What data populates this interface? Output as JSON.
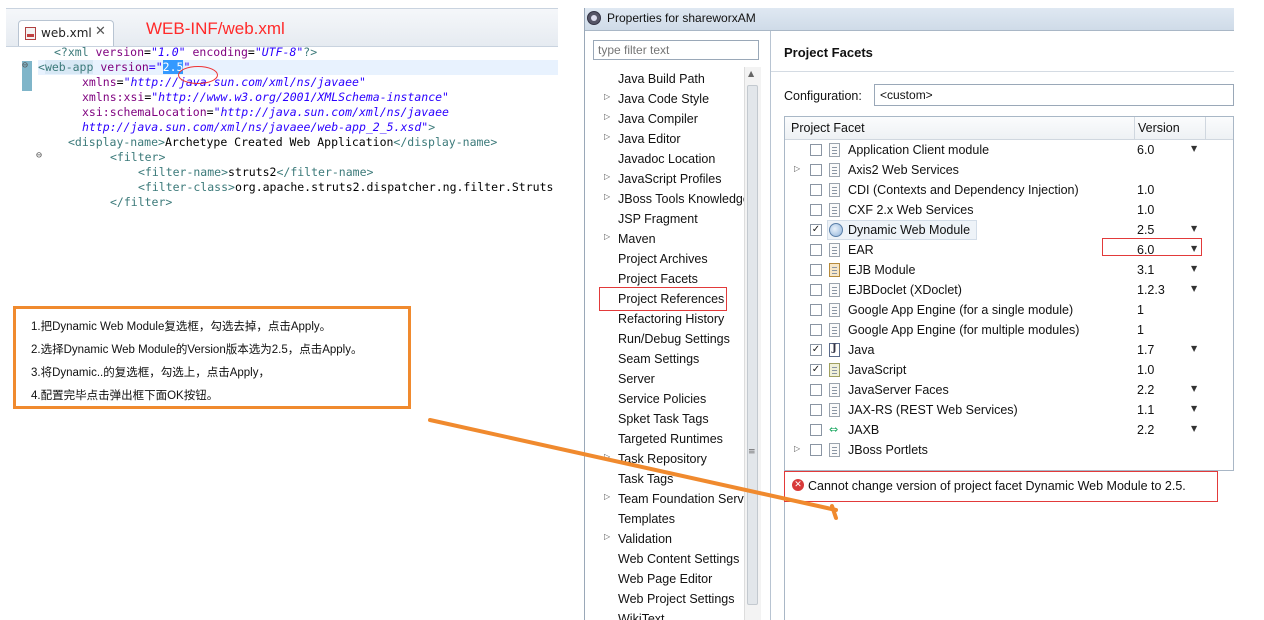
{
  "editor": {
    "tab_label": "web.xml",
    "tab_close": "✕",
    "annotation_title": "WEB-INF/web.xml",
    "code": {
      "l1": {
        "a": "<?xml ",
        "b": "version",
        "c": "=",
        "d": "\"1.0\"",
        "e": " encoding",
        "f": "=",
        "g": "\"UTF-8\"",
        "h": "?>"
      },
      "l2": {
        "a": "<",
        "b": "web-app",
        "c": " version",
        "d": "=\"",
        "e": "2.5",
        "f": "\""
      },
      "l3": {
        "a": "xmlns",
        "b": "=",
        "c": "\"http://java.sun.com/xml/ns/javaee\""
      },
      "l4": {
        "a": "xmlns:xsi",
        "b": "=",
        "c": "\"http://www.w3.org/2001/XMLSchema-instance\""
      },
      "l5": {
        "a": "xsi:schemaLocation",
        "b": "=",
        "c": "\"http://java.sun.com/xml/ns/javaee"
      },
      "l6": {
        "a": "http://java.sun.com/xml/ns/javaee/web-app_2_5.xsd\"",
        "b": ">"
      },
      "l7": {
        "a": "<display-name>",
        "b": "Archetype Created Web Application",
        "c": "</display-name>"
      },
      "l8": {
        "a": "<filter>"
      },
      "l9": {
        "a": "<filter-name>",
        "b": "struts2",
        "c": "</filter-name>"
      },
      "l10": {
        "a": "<filter-class>",
        "b": "org.apache.struts2.dispatcher.ng.filter.Struts"
      },
      "l11": {
        "a": "</filter>"
      }
    }
  },
  "instructions": [
    "1.把Dynamic Web Module复选框，勾选去掉，点击Apply。",
    "2.选择Dynamic Web Module的Version版本选为2.5，点击Apply。",
    "3.将Dynamic..的复选框，勾选上，点击Apply，",
    "4.配置完毕点击弹出框下面OK按钮。"
  ],
  "dialog": {
    "title": "Properties for shareworxAM",
    "filter_placeholder": "type filter text",
    "nav_items": [
      {
        "label": "Java Build Path",
        "expandable": false
      },
      {
        "label": "Java Code Style",
        "expandable": true
      },
      {
        "label": "Java Compiler",
        "expandable": true
      },
      {
        "label": "Java Editor",
        "expandable": true
      },
      {
        "label": "Javadoc Location",
        "expandable": false
      },
      {
        "label": "JavaScript Profiles",
        "expandable": true
      },
      {
        "label": "JBoss Tools Knowledge",
        "expandable": true
      },
      {
        "label": "JSP Fragment",
        "expandable": false
      },
      {
        "label": "Maven",
        "expandable": true
      },
      {
        "label": "Project Archives",
        "expandable": false
      },
      {
        "label": "Project Facets",
        "expandable": false,
        "selected": true
      },
      {
        "label": "Project References",
        "expandable": false
      },
      {
        "label": "Refactoring History",
        "expandable": false
      },
      {
        "label": "Run/Debug Settings",
        "expandable": false
      },
      {
        "label": "Seam Settings",
        "expandable": false
      },
      {
        "label": "Server",
        "expandable": false
      },
      {
        "label": "Service Policies",
        "expandable": false
      },
      {
        "label": "Spket Task Tags",
        "expandable": false
      },
      {
        "label": "Targeted Runtimes",
        "expandable": false
      },
      {
        "label": "Task Repository",
        "expandable": true
      },
      {
        "label": "Task Tags",
        "expandable": false
      },
      {
        "label": "Team Foundation Server",
        "expandable": true
      },
      {
        "label": "Templates",
        "expandable": false
      },
      {
        "label": "Validation",
        "expandable": true
      },
      {
        "label": "Web Content Settings",
        "expandable": false
      },
      {
        "label": "Web Page Editor",
        "expandable": false
      },
      {
        "label": "Web Project Settings",
        "expandable": false
      },
      {
        "label": "WikiText",
        "expandable": false
      }
    ],
    "content_title": "Project Facets",
    "config_label": "Configuration:",
    "config_value": "<custom>",
    "table_headers": {
      "facet": "Project Facet",
      "version": "Version"
    },
    "facets": [
      {
        "name": "Application Client module",
        "version": "6.0",
        "checked": false,
        "dropdown": true,
        "expandable": false,
        "icon": "doc"
      },
      {
        "name": "Axis2 Web Services",
        "version": "",
        "checked": false,
        "dropdown": false,
        "expandable": true,
        "icon": "doc"
      },
      {
        "name": "CDI (Contexts and Dependency Injection)",
        "version": "1.0",
        "checked": false,
        "dropdown": false,
        "expandable": false,
        "icon": "doc"
      },
      {
        "name": "CXF 2.x Web Services",
        "version": "1.0",
        "checked": false,
        "dropdown": false,
        "expandable": false,
        "icon": "doc"
      },
      {
        "name": "Dynamic Web Module",
        "version": "2.5",
        "checked": true,
        "dropdown": true,
        "expandable": false,
        "icon": "web",
        "selected": true
      },
      {
        "name": "EAR",
        "version": "6.0",
        "checked": false,
        "dropdown": true,
        "expandable": false,
        "icon": "doc"
      },
      {
        "name": "EJB Module",
        "version": "3.1",
        "checked": false,
        "dropdown": true,
        "expandable": false,
        "icon": "ejb"
      },
      {
        "name": "EJBDoclet (XDoclet)",
        "version": "1.2.3",
        "checked": false,
        "dropdown": true,
        "expandable": false,
        "icon": "doc"
      },
      {
        "name": "Google App Engine (for a single module)",
        "version": "1",
        "checked": false,
        "dropdown": false,
        "expandable": false,
        "icon": "doc"
      },
      {
        "name": "Google App Engine (for multiple modules)",
        "version": "1",
        "checked": false,
        "dropdown": false,
        "expandable": false,
        "icon": "doc"
      },
      {
        "name": "Java",
        "version": "1.7",
        "checked": true,
        "dropdown": true,
        "expandable": false,
        "icon": "java"
      },
      {
        "name": "JavaScript",
        "version": "1.0",
        "checked": true,
        "dropdown": false,
        "expandable": false,
        "icon": "js"
      },
      {
        "name": "JavaServer Faces",
        "version": "2.2",
        "checked": false,
        "dropdown": true,
        "expandable": false,
        "icon": "doc"
      },
      {
        "name": "JAX-RS (REST Web Services)",
        "version": "1.1",
        "checked": false,
        "dropdown": true,
        "expandable": false,
        "icon": "doc"
      },
      {
        "name": "JAXB",
        "version": "2.2",
        "checked": false,
        "dropdown": true,
        "expandable": false,
        "icon": "jaxb"
      },
      {
        "name": "JBoss Portlets",
        "version": "",
        "checked": false,
        "dropdown": false,
        "expandable": true,
        "icon": "doc"
      }
    ],
    "error_icon": "✕",
    "error_message": "Cannot change version of project facet Dynamic Web Module to 2.5."
  },
  "colors": {
    "annotation": "#ff2a2a",
    "highlight_box": "#f08a2e",
    "error_border": "#e23a3a"
  }
}
